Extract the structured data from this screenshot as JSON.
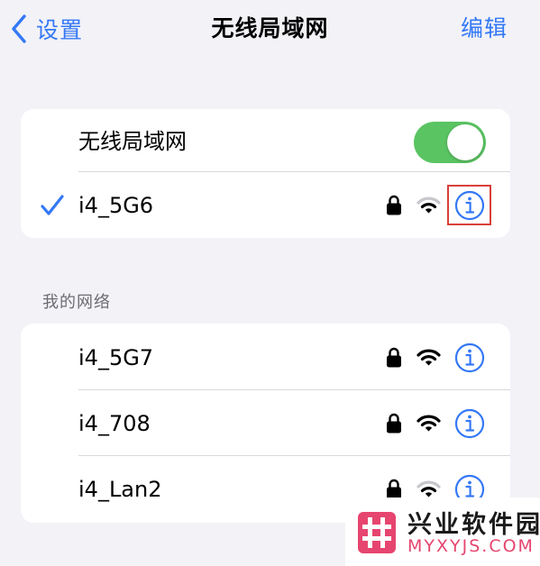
{
  "nav": {
    "back_label": "设置",
    "title": "无线局域网",
    "edit_label": "编辑"
  },
  "wifi_toggle": {
    "label": "无线局域网",
    "on": true
  },
  "connected_network": {
    "ssid": "i4_5G6",
    "locked": true,
    "signal": "wifi-medium",
    "connected": true
  },
  "my_networks": {
    "header": "我的网络",
    "items": [
      {
        "ssid": "i4_5G7",
        "locked": true,
        "signal": "wifi-full"
      },
      {
        "ssid": "i4_708",
        "locked": true,
        "signal": "wifi-full"
      },
      {
        "ssid": "i4_Lan2",
        "locked": true,
        "signal": "wifi-medium"
      }
    ]
  },
  "watermark": {
    "name": "兴业软件园",
    "domain": "MYXYJS.COM"
  },
  "colors": {
    "accent": "#3478f6",
    "toggle_on": "#5ac462",
    "background": "#f2f2f7",
    "highlight_box": "#d9403a",
    "watermark_pink": "#e6456f"
  }
}
